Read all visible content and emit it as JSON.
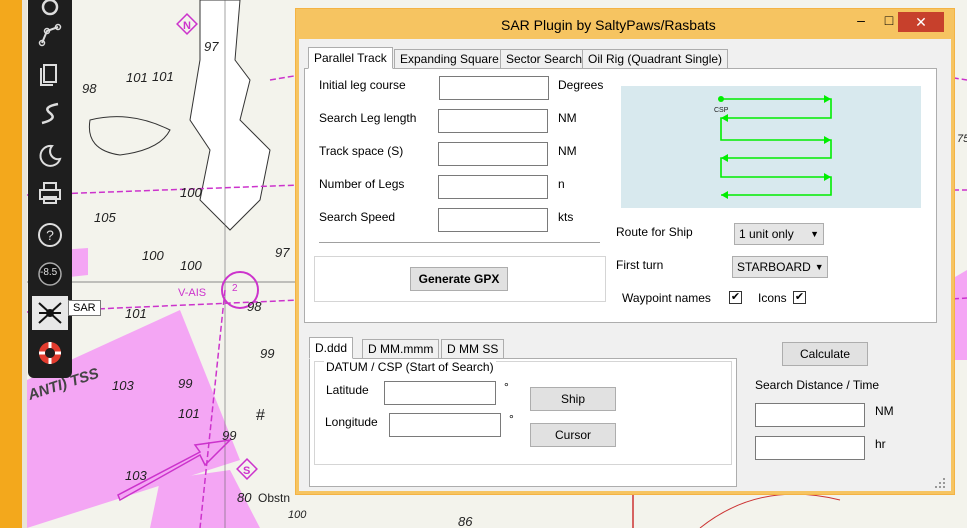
{
  "chart": {
    "depths": [
      "98",
      "101",
      "97",
      "101",
      "100",
      "105",
      "97",
      "100",
      "100",
      "101",
      "98",
      "103",
      "99",
      "103",
      "99",
      "99",
      "101",
      "80",
      "100",
      "86",
      "75"
    ],
    "labels": [
      "V-AIS",
      "ANTI) TSS",
      "Obstn",
      "2",
      "N",
      "S",
      "#"
    ],
    "colors": {
      "sea": "#f3f3ec",
      "tss": "#f4a6f4",
      "lane": "#cc33cc",
      "land": "#ffffff",
      "contour": "#333333"
    }
  },
  "toolbar": {
    "items": [
      {
        "name": "settings-icon"
      },
      {
        "name": "route-icon"
      },
      {
        "name": "pages-icon"
      },
      {
        "name": "track-icon"
      },
      {
        "name": "night-mode-icon"
      },
      {
        "name": "print-icon"
      },
      {
        "name": "help-icon"
      },
      {
        "name": "compass-icon"
      },
      {
        "name": "sar-icon"
      },
      {
        "name": "lifebuoy-icon"
      }
    ],
    "compass_value": "-8.5",
    "sar_tooltip": "SAR"
  },
  "dialog": {
    "title": "SAR Plugin by SaltyPaws/Rasbats",
    "minimize": "–",
    "maximize": "□",
    "close": "✕",
    "pattern_tabs": [
      "Parallel Track",
      "Expanding Square",
      "Sector Search",
      "Oil Rig (Quadrant Single)"
    ],
    "fields": {
      "initial_leg_course": {
        "label": "Initial leg course",
        "value": "",
        "unit": "Degrees"
      },
      "search_leg_length": {
        "label": "Search Leg length",
        "value": "",
        "unit": "NM"
      },
      "track_space": {
        "label": "Track space (S)",
        "value": "",
        "unit": "NM"
      },
      "number_of_legs": {
        "label": "Number of Legs",
        "value": "",
        "unit": "n"
      },
      "search_speed": {
        "label": "Search Speed",
        "value": "",
        "unit": "kts"
      }
    },
    "generate_gpx": "Generate GPX",
    "diagram": {
      "csp_label": "CSP",
      "bg": "#d8e9ee",
      "track_color": "#00ee00"
    },
    "route_for_ship": {
      "label": "Route for Ship",
      "value": "1 unit only"
    },
    "first_turn": {
      "label": "First turn",
      "value": "STARBOARD"
    },
    "waypoint_names": {
      "label": "Waypoint names",
      "checked": "✔"
    },
    "icons": {
      "label": "Icons",
      "checked": "✔"
    },
    "format_tabs": [
      "D.ddd",
      "D MM.mmm",
      "D MM SS"
    ],
    "datum_title": "DATUM / CSP (Start of Search)",
    "latitude": {
      "label": "Latitude",
      "value": "",
      "unit": "°"
    },
    "longitude": {
      "label": "Longitude",
      "value": "",
      "unit": "°"
    },
    "ship_button": "Ship",
    "cursor_button": "Cursor",
    "calculate_button": "Calculate",
    "search_distance_title": "Search Distance / Time",
    "distance": {
      "value": "",
      "unit": "NM"
    },
    "time": {
      "value": "",
      "unit": "hr"
    }
  }
}
